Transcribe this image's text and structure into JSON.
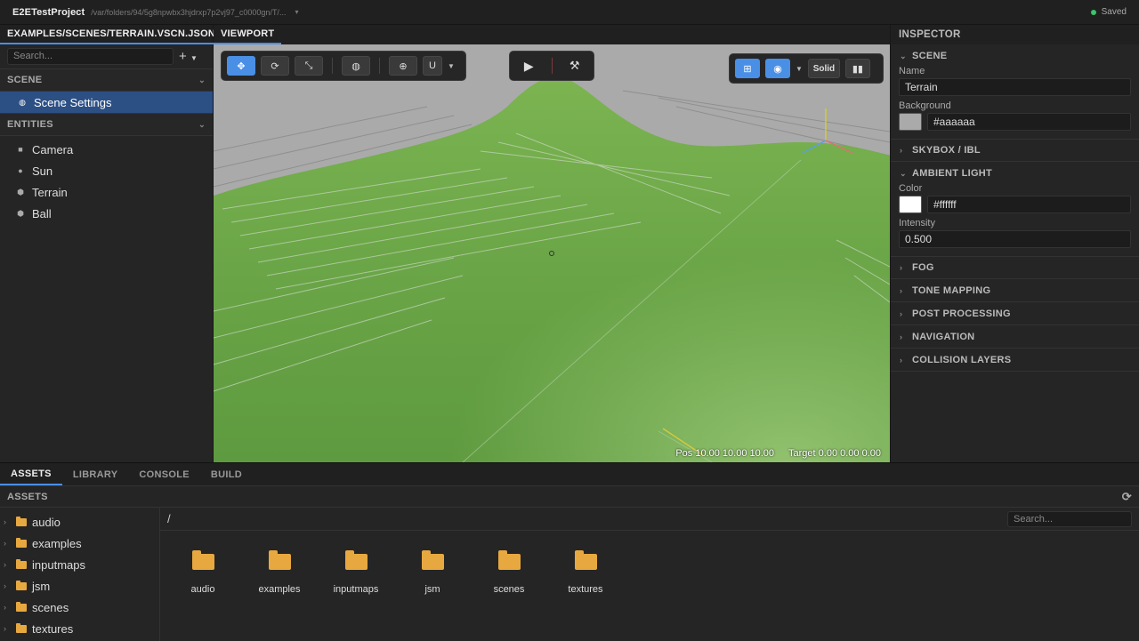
{
  "topbar": {
    "title": "E2ETestProject",
    "path": "/var/folders/94/5g8npwbx3hjdrxp7p2vj97_c0000gn/T/...",
    "status": "Saved"
  },
  "left": {
    "file_tab": "EXAMPLES/SCENES/TERRAIN.VSCN.JSON",
    "search_placeholder": "Search...",
    "add_label": "+",
    "scene_label": "SCENE",
    "scene_settings": "Scene Settings",
    "entities_label": "ENTITIES",
    "entities": [
      {
        "name": "Camera",
        "icon": "camera-icon"
      },
      {
        "name": "Sun",
        "icon": "light-icon"
      },
      {
        "name": "Terrain",
        "icon": "mesh-icon"
      },
      {
        "name": "Ball",
        "icon": "mesh-icon"
      }
    ]
  },
  "viewport": {
    "tab": "VIEWPORT",
    "shading": "Solid",
    "pos": "Pos 10.00 10.00 10.00",
    "target": "Target 0.00 0.00 0.00"
  },
  "inspector": {
    "title": "INSPECTOR",
    "scene": "SCENE",
    "name_label": "Name",
    "name_value": "Terrain",
    "bg_label": "Background",
    "bg_value": "#aaaaaa",
    "skybox": "SKYBOX / IBL",
    "ambient": "AMBIENT LIGHT",
    "color_label": "Color",
    "color_value": "#ffffff",
    "intensity_label": "Intensity",
    "intensity_value": "0.500",
    "fog": "FOG",
    "tone": "TONE MAPPING",
    "post": "POST PROCESSING",
    "nav": "NAVIGATION",
    "collision": "COLLISION LAYERS"
  },
  "bottom": {
    "tabs": [
      "ASSETS",
      "LIBRARY",
      "CONSOLE",
      "BUILD"
    ],
    "assets_label": "ASSETS",
    "crumb": "/",
    "search_placeholder": "Search...",
    "folders": [
      "audio",
      "examples",
      "inputmaps",
      "jsm",
      "scenes",
      "textures"
    ]
  },
  "colors": {
    "accent": "#4a8fe6",
    "selection": "#2c4f84",
    "folder": "#e8a840",
    "terrain": "#6aa84f"
  }
}
